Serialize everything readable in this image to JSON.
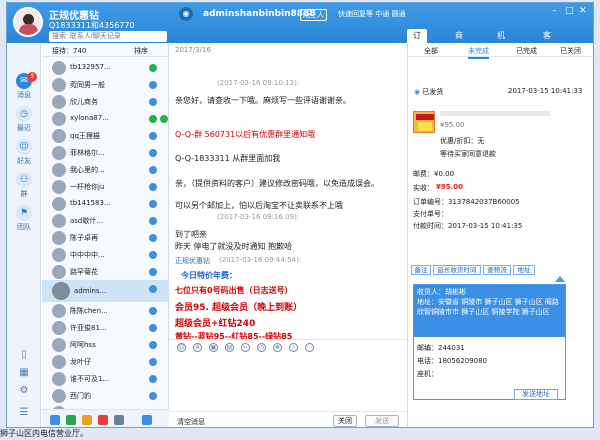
{
  "workspace": {
    "name": "正规优惠钻",
    "account_id": "Q1833311和4356770",
    "search_placeholder": "搜索: 联系人/聊天记录"
  },
  "contact": {
    "name": "adminshanbinbin8888",
    "tag_stranger": "陌生人",
    "status": "快速回复等  中通  圆通"
  },
  "top_tabs": [
    "订单",
    "商品",
    "机器人",
    "客户"
  ],
  "left_nav": [
    {
      "label": "消息",
      "badge": "3"
    },
    {
      "label": "最近"
    },
    {
      "label": "好友"
    },
    {
      "label": "群"
    },
    {
      "label": "团队"
    }
  ],
  "contacts_header": {
    "count_label": "接待：740",
    "sort_label": "排序"
  },
  "contacts": [
    {
      "name": "tb132957..."
    },
    {
      "name": "菀同男一般"
    },
    {
      "name": "欣儿商务"
    },
    {
      "name": "xylona87..."
    },
    {
      "name": "qq王狸猫"
    },
    {
      "name": "菲林格尔..."
    },
    {
      "name": "我心里的..."
    },
    {
      "name": "一杆枪你ju"
    },
    {
      "name": "tb141583..."
    },
    {
      "name": "asd歇什..."
    },
    {
      "name": "陈子卓再"
    },
    {
      "name": "中中中中..."
    },
    {
      "name": "路罕菊花"
    },
    {
      "name": "admins..."
    },
    {
      "name": "陈陈chen..."
    },
    {
      "name": "许亚俊81..."
    },
    {
      "name": "阿呵hss"
    },
    {
      "name": "龙叶仔"
    },
    {
      "name": "谁不可及1..."
    },
    {
      "name": "西门豹"
    },
    {
      "name": "佐伊伊"
    }
  ],
  "chat": {
    "date": "2017/3/16",
    "ts1": "(2017-03-16 09:10:12):",
    "l1": "亲您好，请查收一下哦。麻烦写一些评语谢谢亲。",
    "l2": "Q-Q-群   560731以后有优惠群里通知哦",
    "l3": "Q-Q-1833311 从群里面加我",
    "l4": "亲，（提供资料的客户）建议修改密码哦，以免造成误会。",
    "l5": "可以另个邮加上，怕以后淘宝不让卖联系不上哦",
    "ts2": "(2017-03-16 09:16:09):",
    "l6": "到了吧亲",
    "l7": "昨天 停电了就没及时通知 抱歉哈",
    "sender": "正规优惠钻",
    "ts3": "(2017-03-16 09:44:54):",
    "l8": "今日特价年费：",
    "l9": "七位只有0号码出售（日志送号）",
    "l10": "会员95. 超级会员（晚上到账）",
    "l11": "超级会员+红钻240",
    "l12": "黄钻--蓝钻95--红钻85--绿钻85",
    "close_window": "清空消息",
    "close_btn": "关闭",
    "send_btn": "发送"
  },
  "panel": {
    "subtabs": [
      "全部",
      "未完成",
      "已完成",
      "已关闭"
    ],
    "status_label": "已发货",
    "order_time": "2017-03-15 10:41:33",
    "price": "¥95.00",
    "coupon_label": "优惠/折扣：无",
    "waiting": "等待买家同意退款",
    "postage": "邮费：¥0.00",
    "paid_label": "实收：",
    "paid_value": "¥95.00",
    "order_id": "订单编号：3137842037B60005",
    "trade_id": "支付单号：",
    "pay_time": "付款时间：2017-03-15 10:41:35",
    "btn_note": "备注",
    "btn_delay": "延长收货时间",
    "btn_logistics": "查物流",
    "btn_addr": "地址",
    "receiver": "收货人：胡彬彬",
    "address": "地址：安徽省 铜陵市 狮子山区 狮子山区 阁路欣智铜陵市市 狮子山区 铜陵学院 狮子山区",
    "zip": "邮编：244031",
    "phone": "电话：18056209080",
    "landline": "座机：",
    "send_addr": "发送地址"
  },
  "below_text": "狮子山区内电信营业厅。"
}
